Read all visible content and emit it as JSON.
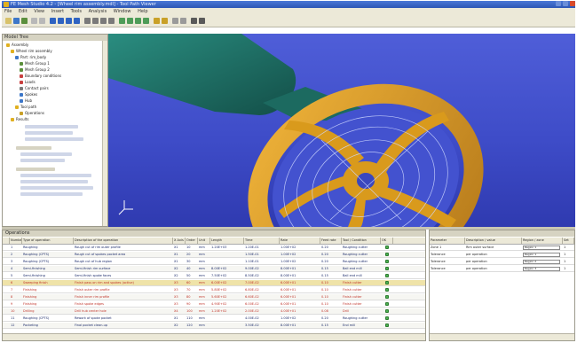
{
  "window": {
    "title": "FE Mesh Studio 4.2 - [Wheel rim assembly.mdl] - Tool Path Viewer"
  },
  "menubar": {
    "items": [
      "File",
      "Edit",
      "View",
      "Insert",
      "Tools",
      "Analysis",
      "Window",
      "Help"
    ]
  },
  "tree": {
    "header": "Model Tree",
    "items": [
      "Assembly",
      "Wheel rim assembly",
      "Part: rim_body",
      "Mesh Group 1",
      "Mesh Group 2",
      "Boundary conditions",
      "Loads",
      "Contact pairs",
      "Spokes",
      "Hub",
      "Tool path",
      "Operations",
      "Results"
    ]
  },
  "grid": {
    "title": "Operations",
    "headers": [
      "",
      "Number",
      "Type of operation",
      "Description of the operation",
      "X Axis",
      "Order",
      "Unit",
      "Length",
      "Time",
      "Rate",
      "Feed rate",
      "Tool / Condition",
      "OK"
    ],
    "rows": [
      {
        "n": "1",
        "type": "Roughing",
        "desc": "Rough cut of rim outer profile",
        "x": "X1",
        "order": "10",
        "unit": "mm",
        "len": "1.20E+03",
        "time": "1.20E-01",
        "rate": "1.00E+02",
        "feed": "0.20",
        "tool": "Roughing cutter",
        "red": false
      },
      {
        "n": "2",
        "type": "Roughing (CPTS)",
        "desc": "Rough cut of spokes pocket area",
        "x": "X1",
        "order": "20",
        "unit": "mm",
        "len": "",
        "time": "1.50E-01",
        "rate": "1.00E+02",
        "feed": "0.20",
        "tool": "Roughing cutter",
        "red": false
      },
      {
        "n": "3",
        "type": "Roughing (CPTS)",
        "desc": "Rough cut of hub region",
        "x": "X1",
        "order": "30",
        "unit": "mm",
        "len": "",
        "time": "1.10E-01",
        "rate": "1.00E+02",
        "feed": "0.20",
        "tool": "Roughing cutter",
        "red": false
      },
      {
        "n": "4",
        "type": "Semi-finishing",
        "desc": "Semi-finish rim surface",
        "x": "X2",
        "order": "40",
        "unit": "mm",
        "len": "8.00E+02",
        "time": "9.00E-02",
        "rate": "8.00E+01",
        "feed": "0.15",
        "tool": "Ball end mill",
        "red": false
      },
      {
        "n": "5",
        "type": "Semi-finishing",
        "desc": "Semi-finish spoke faces",
        "x": "X2",
        "order": "50",
        "unit": "mm",
        "len": "7.50E+02",
        "time": "8.50E-02",
        "rate": "8.00E+01",
        "feed": "0.15",
        "tool": "Ball end mill",
        "red": false
      },
      {
        "n": "6",
        "type": "Sweeping finish",
        "desc": "Finish pass on rim and spokes (active)",
        "x": "X3",
        "order": "60",
        "unit": "mm",
        "len": "6.00E+02",
        "time": "7.00E-02",
        "rate": "6.00E+01",
        "feed": "0.10",
        "tool": "Finish cutter",
        "red": true
      },
      {
        "n": "7",
        "type": "Finishing",
        "desc": "Finish outer rim profile",
        "x": "X3",
        "order": "70",
        "unit": "mm",
        "len": "5.80E+02",
        "time": "6.80E-02",
        "rate": "6.00E+01",
        "feed": "0.10",
        "tool": "Finish cutter",
        "red": true
      },
      {
        "n": "8",
        "type": "Finishing",
        "desc": "Finish inner rim profile",
        "x": "X3",
        "order": "80",
        "unit": "mm",
        "len": "5.60E+02",
        "time": "6.60E-02",
        "rate": "6.00E+01",
        "feed": "0.10",
        "tool": "Finish cutter",
        "red": true
      },
      {
        "n": "9",
        "type": "Finishing",
        "desc": "Finish spoke edges",
        "x": "X3",
        "order": "90",
        "unit": "mm",
        "len": "4.90E+02",
        "time": "6.00E-02",
        "rate": "6.00E+01",
        "feed": "0.10",
        "tool": "Finish cutter",
        "red": true
      },
      {
        "n": "10",
        "type": "Drilling",
        "desc": "Drill hub center hole",
        "x": "X4",
        "order": "100",
        "unit": "mm",
        "len": "1.20E+02",
        "time": "2.00E-02",
        "rate": "4.00E+01",
        "feed": "0.08",
        "tool": "Drill",
        "red": true
      },
      {
        "n": "11",
        "type": "Roughing (CPTS)",
        "desc": "Rework of spoke pocket",
        "x": "X1",
        "order": "110",
        "unit": "mm",
        "len": "",
        "time": "4.00E-02",
        "rate": "1.00E+02",
        "feed": "0.20",
        "tool": "Roughing cutter",
        "red": false
      },
      {
        "n": "12",
        "type": "Pocketing",
        "desc": "Final pocket clean-up",
        "x": "X2",
        "order": "120",
        "unit": "mm",
        "len": "",
        "time": "3.50E-02",
        "rate": "8.00E+01",
        "feed": "0.15",
        "tool": "End mill",
        "red": false
      }
    ]
  },
  "side": {
    "headers": [
      "Parameter",
      "Description / value",
      "Region / zone",
      "Set"
    ],
    "rows": [
      {
        "param": "Zone 1",
        "desc": "Rim outer surface",
        "region": "Region 1",
        "set": "1"
      },
      {
        "param": "Tolerance",
        "desc": "per operation",
        "region": "Region 1",
        "set": "1"
      },
      {
        "param": "Tolerance",
        "desc": "per operation",
        "region": "Region 2",
        "set": "1"
      },
      {
        "param": "Tolerance",
        "desc": "per operation",
        "region": "Region 3",
        "set": "1"
      }
    ]
  },
  "colors": {
    "viewport": "#3f4dc8",
    "part": "#d99a1c",
    "tool": "#1f7a6e",
    "active_row": "#efe3a8",
    "red_text": "#c0342a"
  },
  "icons": [
    "app-icon",
    "close-icon",
    "maximize-icon",
    "minimize-icon",
    "folder-icon",
    "check-icon",
    "dropdown-icon",
    "axis-triad-icon"
  ]
}
